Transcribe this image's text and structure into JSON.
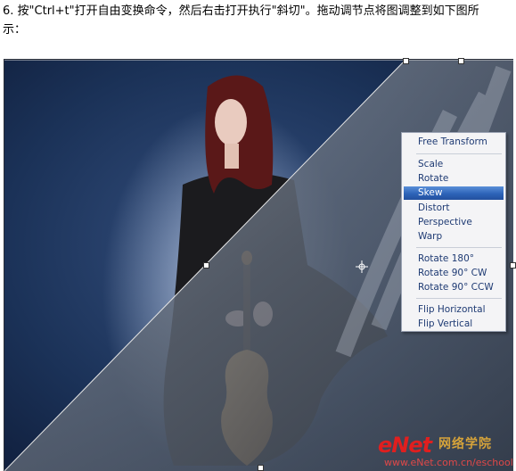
{
  "instruction": {
    "line1": "6. 按\"Ctrl+t\"打开自由变换命令，然后右击打开执行\"斜切\"。拖动调节点将图调整到如下图所",
    "line2": "示："
  },
  "context_menu": {
    "groups": [
      [
        "Free Transform"
      ],
      [
        "Scale",
        "Rotate",
        "Skew",
        "Distort",
        "Perspective",
        "Warp"
      ],
      [
        "Rotate 180°",
        "Rotate 90° CW",
        "Rotate 90° CCW"
      ],
      [
        "Flip Horizontal",
        "Flip Vertical"
      ]
    ],
    "active_item": "Skew"
  },
  "watermark": {
    "logo": "eNet",
    "cn": "网络学院",
    "url": "www.eNet.com.cn/eschool"
  },
  "colors": {
    "menu_text": "#1e3a73",
    "menu_highlight": "#2d63b8",
    "watermark_red": "#e01f1f",
    "sky_blue": "#1d3560"
  }
}
